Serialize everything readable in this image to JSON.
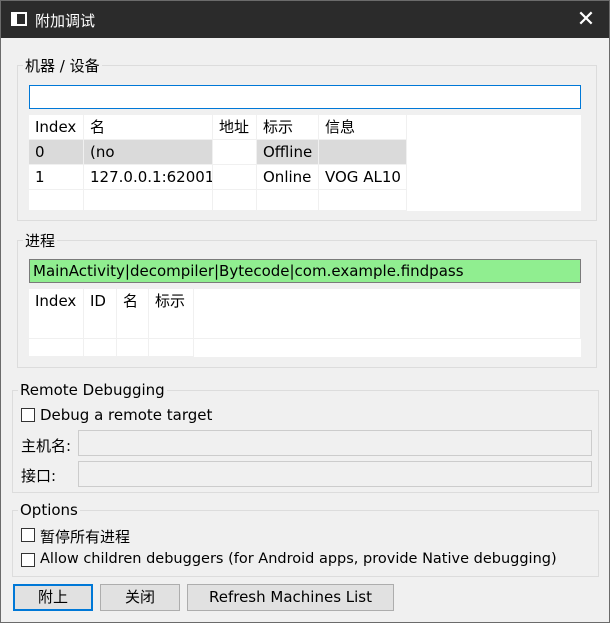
{
  "window": {
    "title": "附加调试",
    "close_glyph": "✕"
  },
  "machines": {
    "group_label": "机器 / 设备",
    "filter_value": "",
    "columns": [
      "Index",
      "名",
      "地址",
      "标示",
      "信息"
    ],
    "rows": [
      [
        "0",
        "(no",
        "",
        "Offline",
        ""
      ],
      [
        "1",
        "127.0.0.1:62001",
        "",
        "Online",
        "VOG AL10"
      ]
    ]
  },
  "process": {
    "group_label": "进程",
    "filter_value": "MainActivity|decompiler|Bytecode|com.example.findpass",
    "columns": [
      "Index",
      "ID",
      "名",
      "标示"
    ]
  },
  "remote": {
    "group_label": "Remote Debugging",
    "checkbox_label": "Debug a remote target",
    "host_label": "主机名:",
    "host_value": "",
    "port_label": "接口:",
    "port_value": ""
  },
  "options": {
    "group_label": "Options",
    "pause_label": "暂停所有进程",
    "children_label": "Allow children debuggers (for Android apps, provide Native debugging)"
  },
  "buttons": {
    "attach": "附上",
    "close": "关闭",
    "refresh": "Refresh Machines List"
  },
  "colors": {
    "titlebar": "#2b2b2b",
    "filter_match": "#90ee90",
    "focus": "#0078d7",
    "selected_row": "#dadada"
  }
}
